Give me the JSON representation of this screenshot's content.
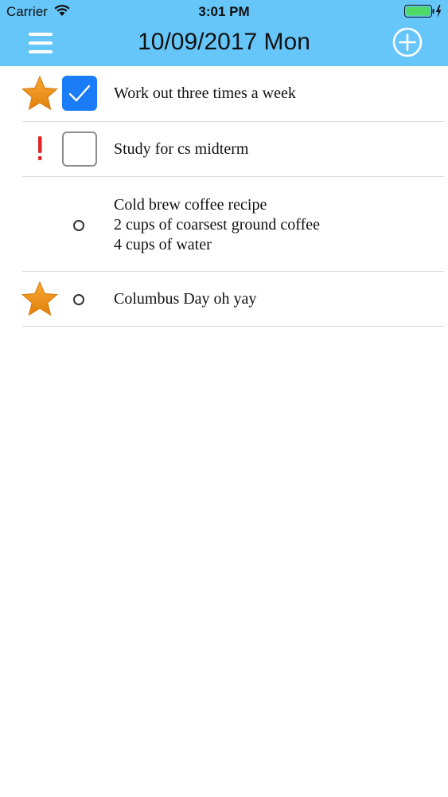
{
  "status_bar": {
    "carrier": "Carrier",
    "time": "3:01 PM",
    "battery_color": "#4cd964"
  },
  "nav": {
    "title": "10/09/2017 Mon",
    "menu_icon": "hamburger-menu-icon",
    "add_icon": "plus-circle-icon",
    "bar_color": "#66c6fa"
  },
  "tasks": [
    {
      "priority": "star",
      "state": "checked",
      "lines": [
        "Work out three times a week"
      ]
    },
    {
      "priority": "exclamation",
      "state": "unchecked",
      "lines": [
        "Study for cs midterm"
      ]
    },
    {
      "priority": "none",
      "state": "note",
      "lines": [
        "Cold brew coffee recipe",
        "2 cups of coarsest ground coffee",
        "4 cups of water"
      ]
    },
    {
      "priority": "star",
      "state": "note",
      "lines": [
        "Columbus Day oh yay"
      ]
    }
  ],
  "colors": {
    "star": "#f0921c",
    "exclamation": "#e02424",
    "checkbox_checked": "#1a7cf7"
  }
}
